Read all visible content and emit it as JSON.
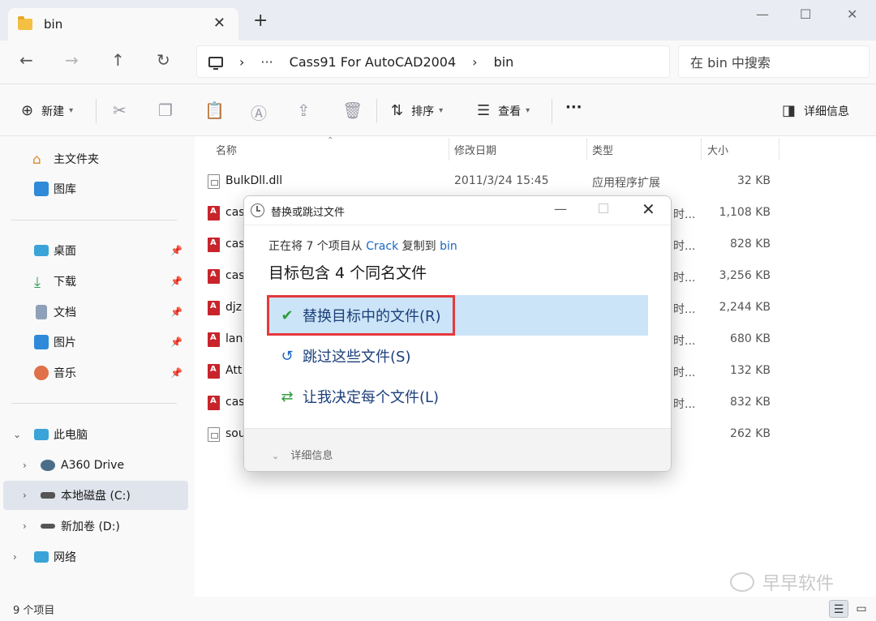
{
  "window": {
    "tab_title": "bin",
    "tab_close": "✕",
    "new_tab": "+",
    "minimize": "—",
    "maximize": "☐",
    "close": "✕"
  },
  "address": {
    "segments": [
      "Cass91 For AutoCAD2004",
      "bin"
    ],
    "ellipsis": "···",
    "sep": "›",
    "search_placeholder": "在 bin 中搜索"
  },
  "toolbar": {
    "new_label": "新建",
    "sort_label": "排序",
    "view_label": "查看",
    "more": "···",
    "details_label": "详细信息"
  },
  "sidebar": {
    "home": "主文件夹",
    "gallery": "图库",
    "desktop": "桌面",
    "downloads": "下载",
    "documents": "文档",
    "pictures": "图片",
    "music": "音乐",
    "this_pc": "此电脑",
    "a360": "A360 Drive",
    "c_drive": "本地磁盘 (C:)",
    "d_drive": "新加卷 (D:)",
    "network": "网络"
  },
  "columns": {
    "name": "名称",
    "date": "修改日期",
    "type": "类型",
    "size": "大小"
  },
  "files": [
    {
      "name": "BulkDll.dll",
      "date": "2011/3/24 15:45",
      "type": "应用程序扩展",
      "size": "32 KB"
    },
    {
      "name": "cas",
      "date": "",
      "type": "时...",
      "size": "1,108 KB"
    },
    {
      "name": "cas",
      "date": "",
      "type": "时...",
      "size": "828 KB"
    },
    {
      "name": "cas",
      "date": "",
      "type": "时...",
      "size": "3,256 KB"
    },
    {
      "name": "djz",
      "date": "",
      "type": "时...",
      "size": "2,244 KB"
    },
    {
      "name": "lan",
      "date": "",
      "type": "时...",
      "size": "680 KB"
    },
    {
      "name": "Att",
      "date": "",
      "type": "时...",
      "size": "132 KB"
    },
    {
      "name": "cas",
      "date": "",
      "type": "时...",
      "size": "832 KB"
    },
    {
      "name": "sou",
      "date": "",
      "type": "",
      "size": "262 KB"
    }
  ],
  "status": {
    "item_count": "9 个项目"
  },
  "watermark": {
    "text": "早早软件"
  },
  "dialog": {
    "title": "替换或跳过文件",
    "copy_prefix": "正在将 7 个项目从 ",
    "copy_source": "Crack",
    "copy_middle": " 复制到 ",
    "copy_dest": "bin",
    "conflict": "目标包含 4 个同名文件",
    "replace": "替换目标中的文件(R)",
    "skip": "跳过这些文件(S)",
    "decide": "让我决定每个文件(L)",
    "details": "详细信息"
  }
}
